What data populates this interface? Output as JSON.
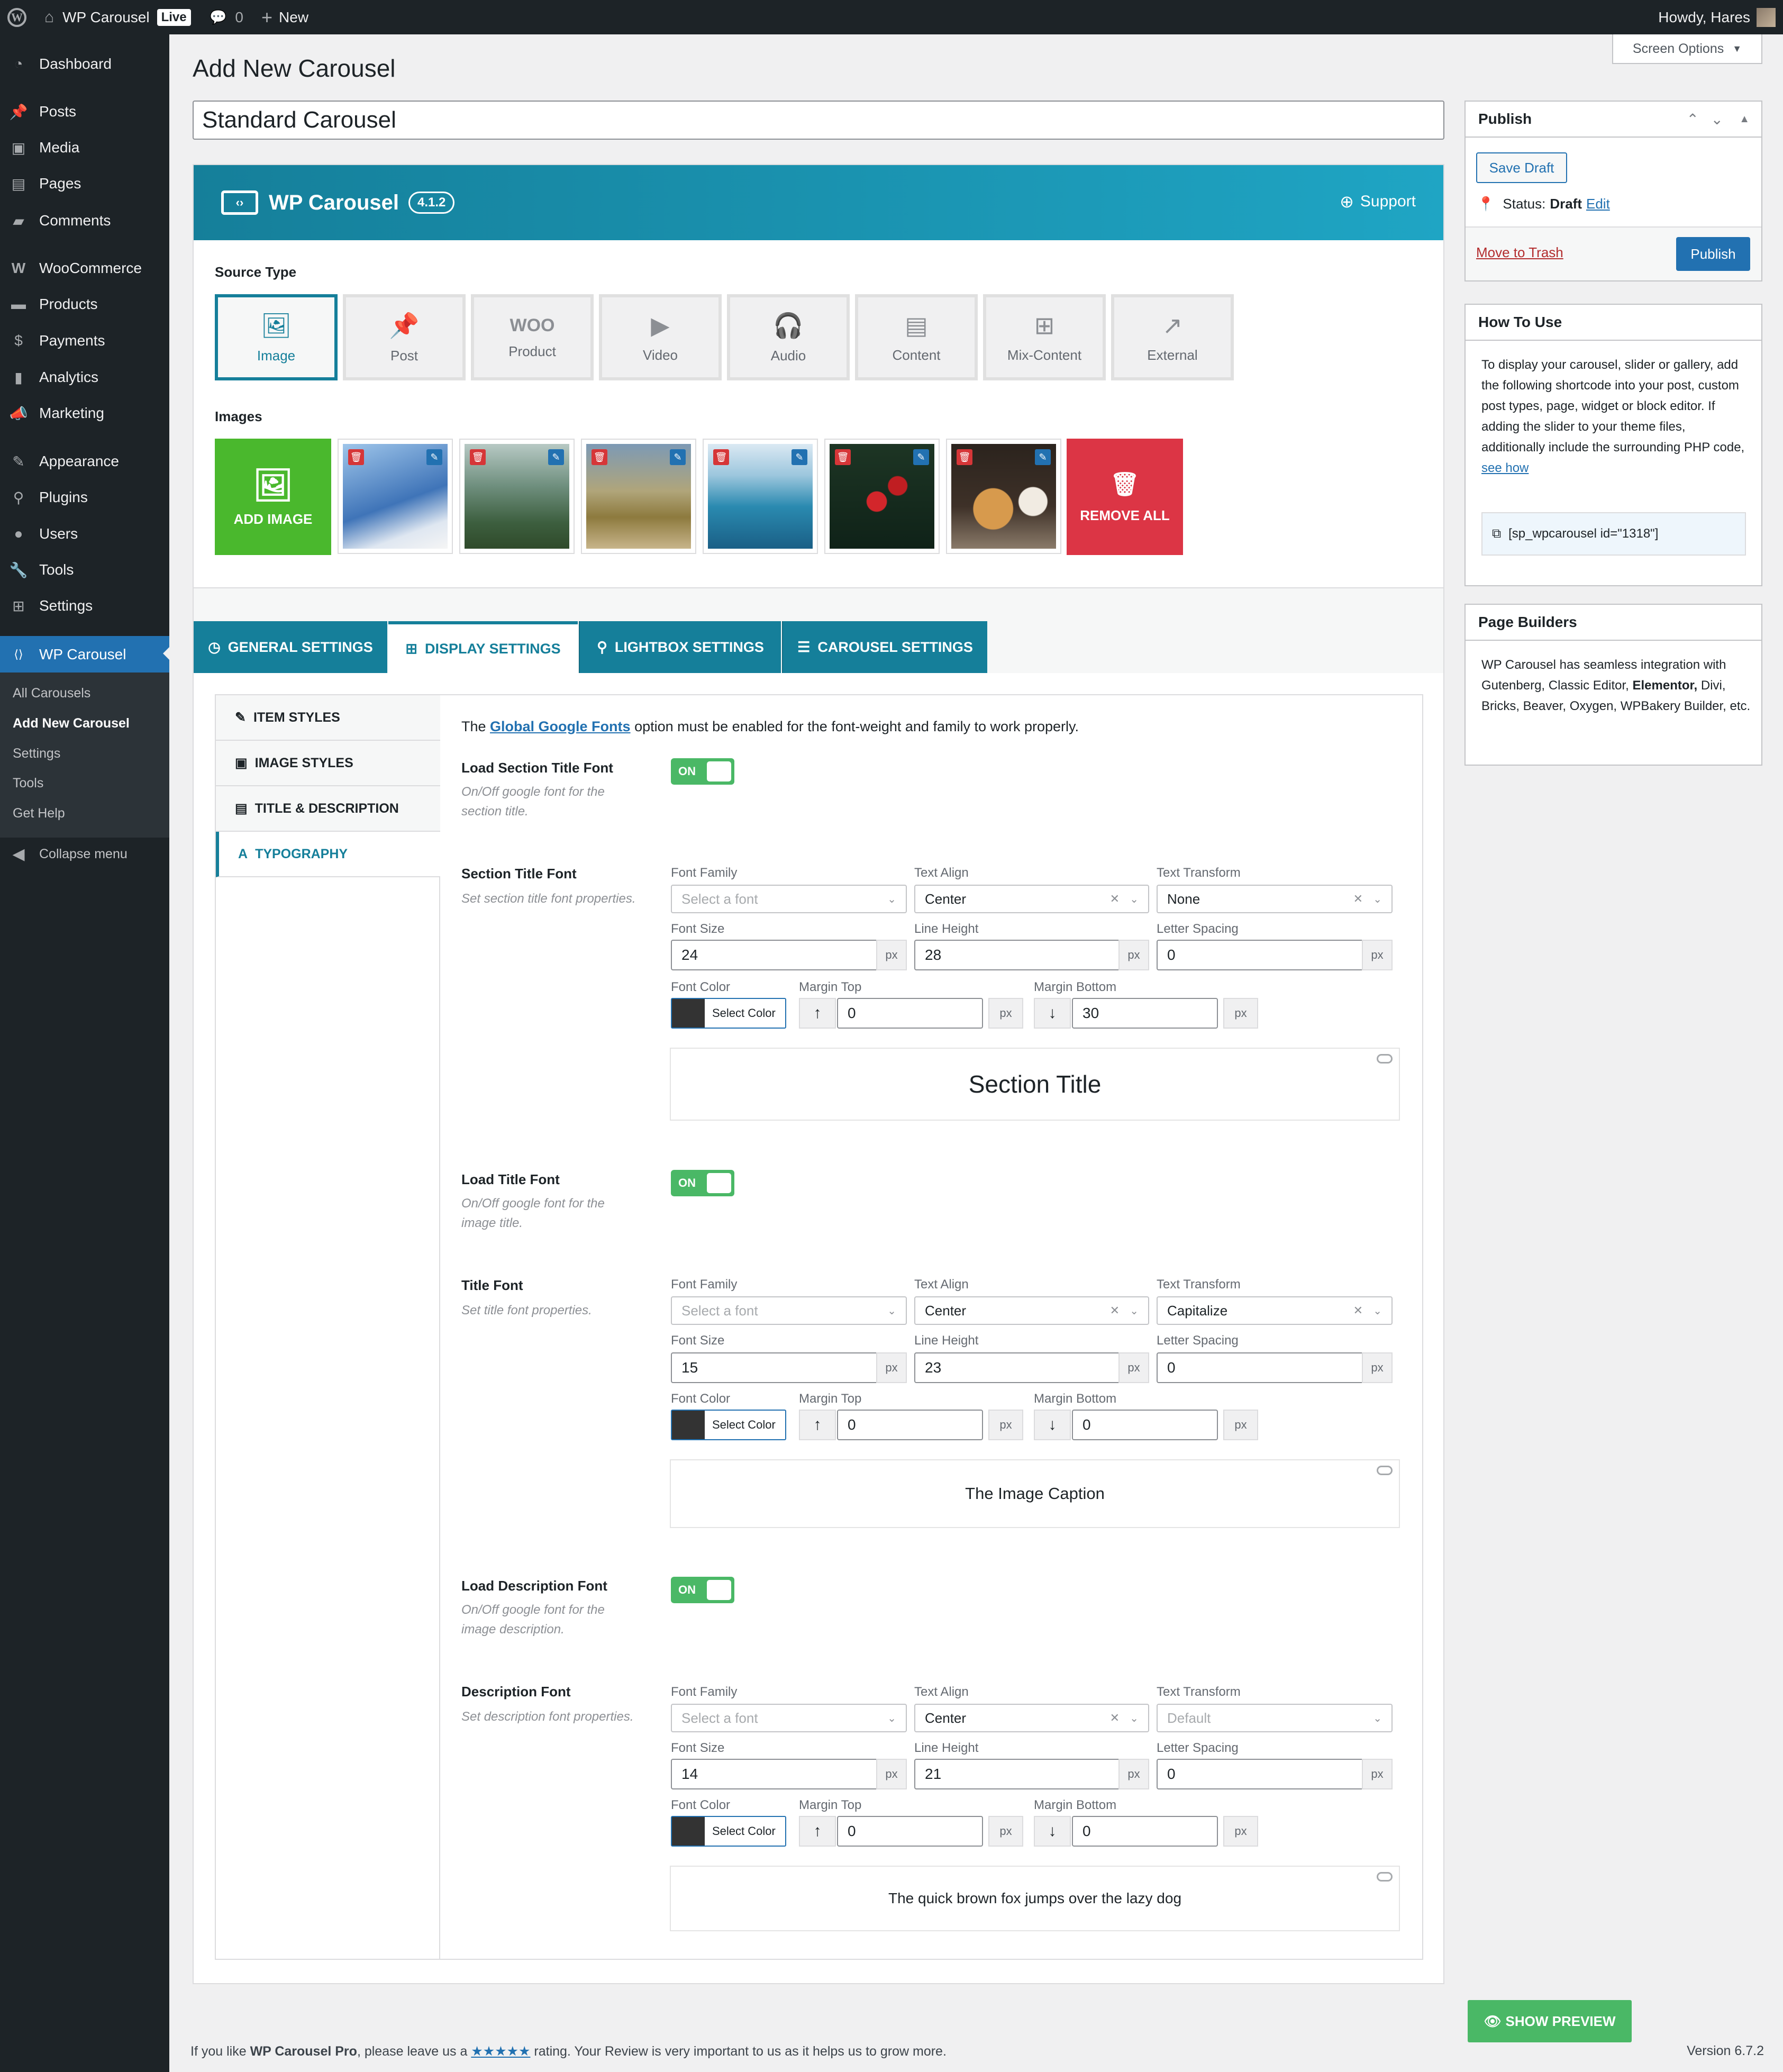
{
  "adminbar": {
    "site_name": "WP Carousel",
    "live_badge": "Live",
    "comments_count": "0",
    "new_label": "New",
    "howdy": "Howdy, Hares"
  },
  "sidebar": {
    "items": [
      {
        "label": "Dashboard",
        "icon": "dashboard-icon"
      },
      {
        "label": "Posts",
        "icon": "pin-icon"
      },
      {
        "label": "Media",
        "icon": "media-icon"
      },
      {
        "label": "Pages",
        "icon": "pages-icon"
      },
      {
        "label": "Comments",
        "icon": "comment-icon"
      },
      {
        "label": "WooCommerce",
        "icon": "woo-icon"
      },
      {
        "label": "Products",
        "icon": "products-icon"
      },
      {
        "label": "Payments",
        "icon": "dollar-icon"
      },
      {
        "label": "Analytics",
        "icon": "chart-icon"
      },
      {
        "label": "Marketing",
        "icon": "megaphone-icon"
      },
      {
        "label": "Appearance",
        "icon": "brush-icon"
      },
      {
        "label": "Plugins",
        "icon": "plugin-icon"
      },
      {
        "label": "Users",
        "icon": "user-icon"
      },
      {
        "label": "Tools",
        "icon": "wrench-icon"
      },
      {
        "label": "Settings",
        "icon": "settings-icon"
      },
      {
        "label": "WP Carousel",
        "icon": "carousel-icon"
      }
    ],
    "submenu": [
      "All Carousels",
      "Add New Carousel",
      "Settings",
      "Tools",
      "Get Help"
    ],
    "collapse": "Collapse menu"
  },
  "screen_options": "Screen Options",
  "page_title": "Add New Carousel",
  "post_title": "Standard Carousel",
  "plugin": {
    "name": "WP Carousel",
    "version": "4.1.2",
    "support": "Support"
  },
  "source_type": {
    "label": "Source Type",
    "options": [
      "Image",
      "Post",
      "Product",
      "Video",
      "Audio",
      "Content",
      "Mix-Content",
      "External"
    ]
  },
  "images": {
    "label": "Images",
    "add": "ADD IMAGE",
    "remove_all": "REMOVE ALL",
    "thumbs": [
      "snowboard-photo",
      "goggles-photo",
      "hiker-photo",
      "coast-photo",
      "berries-photo",
      "pancakes-photo"
    ]
  },
  "tabs": [
    "GENERAL SETTINGS",
    "DISPLAY SETTINGS",
    "LIGHTBOX SETTINGS",
    "CAROUSEL SETTINGS"
  ],
  "subtabs": [
    "ITEM STYLES",
    "IMAGE STYLES",
    "TITLE & DESCRIPTION",
    "TYPOGRAPHY"
  ],
  "typography": {
    "notice_pre": "The",
    "notice_link": "Global Google Fonts",
    "notice_post": "option must be enabled for the font-weight and family to work properly.",
    "labels": {
      "font_family": "Font Family",
      "text_align": "Text Align",
      "text_transform": "Text Transform",
      "font_size": "Font Size",
      "line_height": "Line Height",
      "letter_spacing": "Letter Spacing",
      "font_color": "Font Color",
      "margin_top": "Margin Top",
      "margin_bottom": "Margin Bottom",
      "unit": "px",
      "select_color": "Select Color",
      "font_placeholder": "Select a font",
      "on": "ON"
    },
    "section_load": {
      "title": "Load Section Title Font",
      "help": "On/Off google font for the section title."
    },
    "section_font": {
      "title": "Section Title Font",
      "help": "Set section title font properties.",
      "align": "Center",
      "transform": "None",
      "size": "24",
      "line_height": "28",
      "letter_spacing": "0",
      "margin_top": "0",
      "margin_bottom": "30",
      "preview": "Section Title"
    },
    "title_load": {
      "title": "Load Title Font",
      "help": "On/Off google font for the image title."
    },
    "title_font": {
      "title": "Title Font",
      "help": "Set title font properties.",
      "align": "Center",
      "transform": "Capitalize",
      "size": "15",
      "line_height": "23",
      "letter_spacing": "0",
      "margin_top": "0",
      "margin_bottom": "0",
      "preview": "The Image Caption"
    },
    "desc_load": {
      "title": "Load Description Font",
      "help": "On/Off google font for the image description."
    },
    "desc_font": {
      "title": "Description Font",
      "help": "Set description font properties.",
      "align": "Center",
      "transform": "Default",
      "size": "14",
      "line_height": "21",
      "letter_spacing": "0",
      "margin_top": "0",
      "margin_bottom": "0",
      "preview": "The quick brown fox jumps over the lazy dog"
    }
  },
  "publish": {
    "title": "Publish",
    "save_draft": "Save Draft",
    "status_label": "Status:",
    "status_value": "Draft",
    "edit": "Edit",
    "trash": "Move to Trash",
    "publish": "Publish"
  },
  "how_to": {
    "title": "How To Use",
    "text": "To display your carousel, slider or gallery, add the following shortcode into your post, custom post types, page, widget or block editor. If adding the slider to your theme files, additionally include the surrounding PHP code,",
    "link": "see how",
    "shortcode": "[sp_wpcarousel id=\"1318\"]"
  },
  "builders": {
    "title": "Page Builders",
    "text_pre": "WP Carousel has seamless integration with Gutenberg, Classic Editor,",
    "bold": "Elementor,",
    "text_post": "Divi, Bricks, Beaver, Oxygen, WPBakery Builder, etc."
  },
  "show_preview": "SHOW PREVIEW",
  "footer": {
    "pre": "If you like",
    "bold": "WP Carousel Pro",
    "mid": ", please leave us a",
    "stars": "★★★★★",
    "post": "rating. Your Review is very important to us as it helps us to grow more.",
    "version": "Version 6.7.2"
  },
  "colors": {
    "accent": "#157f9a",
    "wp_blue": "#2271b1",
    "green": "#4ab866",
    "red": "#dc3545"
  }
}
